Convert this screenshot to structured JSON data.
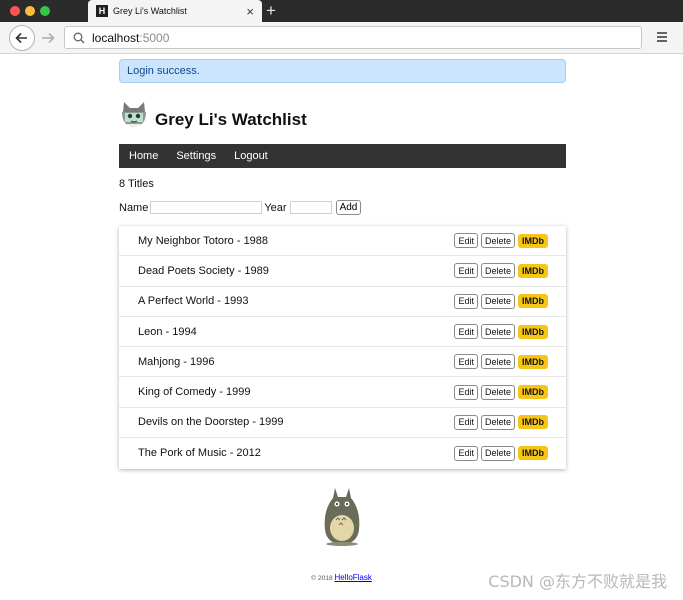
{
  "browser": {
    "tab_title": "Grey Li's Watchlist",
    "tab_favicon": "H",
    "url_host": "localhost",
    "url_port": ":5000"
  },
  "flash": "Login success.",
  "header": {
    "title": "Grey Li's Watchlist"
  },
  "nav": {
    "home": "Home",
    "settings": "Settings",
    "logout": "Logout"
  },
  "count_text": "8 Titles",
  "form": {
    "name_label": "Name",
    "year_label": "Year",
    "add_label": "Add",
    "name_value": "",
    "year_value": ""
  },
  "actions": {
    "edit": "Edit",
    "delete": "Delete",
    "imdb": "IMDb"
  },
  "movies": [
    "My Neighbor Totoro - 1988",
    "Dead Poets Society - 1989",
    "A Perfect World - 1993",
    "Leon - 1994",
    "Mahjong - 1996",
    "King of Comedy - 1999",
    "Devils on the Doorstep - 1999",
    "The Pork of Music - 2012"
  ],
  "footer": {
    "copyright": "© 2018 ",
    "link": "HelloFlask"
  },
  "watermark": "CSDN @东方不败就是我",
  "colors": {
    "imdb": "#f5c518",
    "nav": "#333333",
    "flash_bg": "#cce5ff"
  }
}
